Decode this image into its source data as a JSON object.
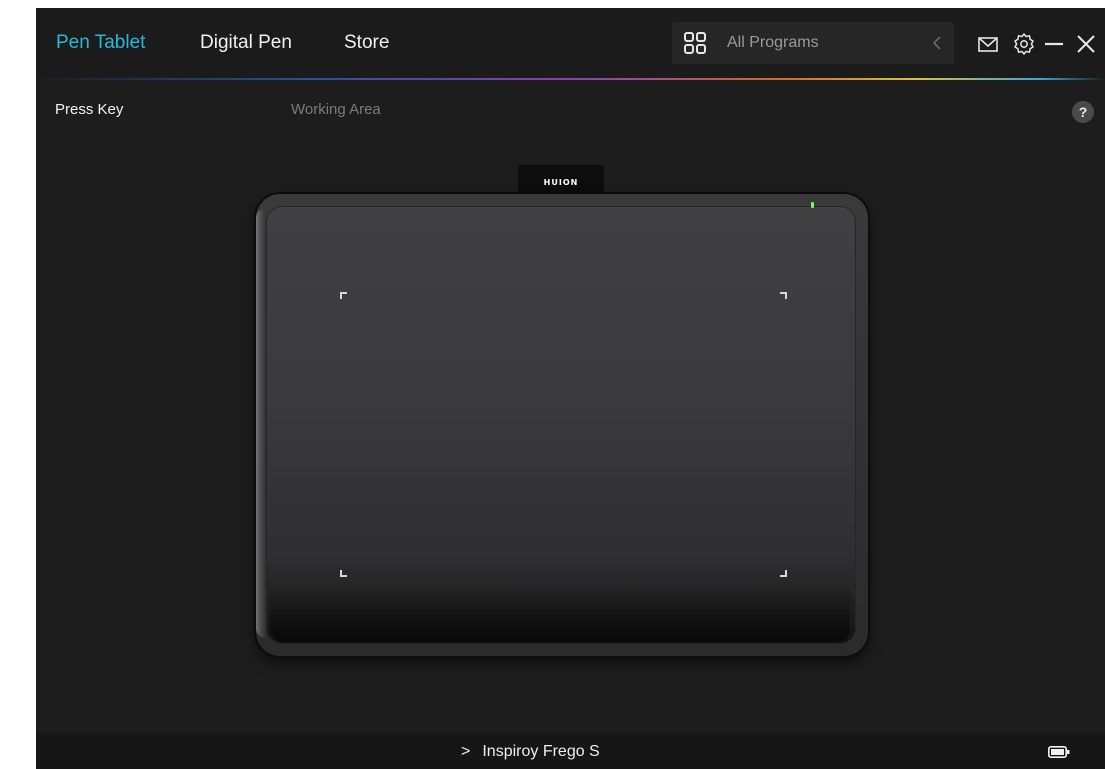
{
  "nav": {
    "tabs": [
      {
        "label": "Pen Tablet",
        "active": true
      },
      {
        "label": "Digital Pen",
        "active": false
      },
      {
        "label": "Store",
        "active": false
      }
    ],
    "programs_selector": {
      "label": "All Programs",
      "icon": "grid-icon",
      "chevron": "chevron-left-icon"
    },
    "window_icons": [
      "mail-icon",
      "gear-icon",
      "minimize-icon",
      "close-icon"
    ]
  },
  "subtabs": [
    {
      "label": "Press Key",
      "active": true
    },
    {
      "label": "Working Area",
      "active": false
    }
  ],
  "help": {
    "label": "?"
  },
  "tablet": {
    "brand_logo": "HUION",
    "status_led_color": "#7cf06a"
  },
  "footer": {
    "device_name": "Inspiroy Frego S",
    "battery_icon": "battery-icon"
  },
  "colors": {
    "accent": "#29b8d6",
    "background": "#1d1d1e",
    "inactive_text": "#7b7b7b"
  }
}
